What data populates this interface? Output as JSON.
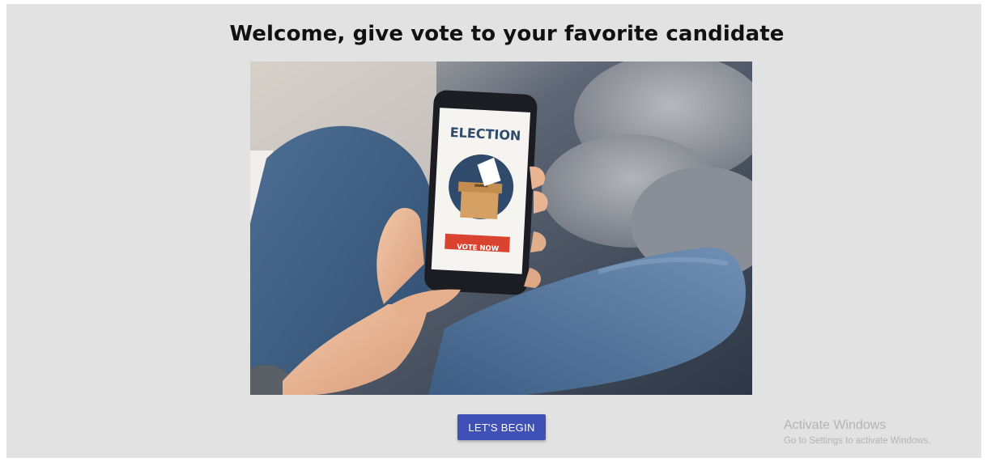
{
  "header": {
    "title": "Welcome, give vote to your favorite candidate"
  },
  "hero": {
    "phone_heading": "ELECTION",
    "phone_button": "VOTE NOW"
  },
  "actions": {
    "begin_label": "LET'S BEGIN"
  },
  "watermark": {
    "line1": "Activate Windows",
    "line2": "Go to Settings to activate Windows."
  },
  "colors": {
    "page_bg": "#e2e2e2",
    "button_bg": "#3f51b5",
    "vote_button": "#d9432f",
    "ballot_circle": "#2f4a6b"
  }
}
